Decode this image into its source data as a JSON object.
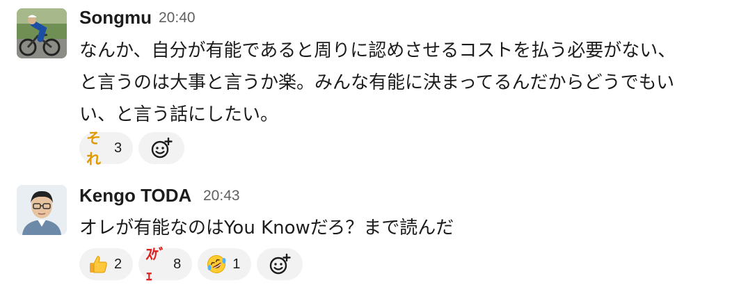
{
  "messages": [
    {
      "author": "Songmu",
      "time": "20:40",
      "lines": [
        "なんか、自分が有能であると周りに認めさせるコストを払う必要がない、",
        "と言うのは大事と言うか楽。みんな有能に決まってるんだからどうでもい",
        "い、と言う話にしたい。"
      ],
      "reactions": [
        {
          "emoji": "それ",
          "emoji_color": "#e09a00",
          "count": "3"
        }
      ]
    },
    {
      "author": "Kengo TODA",
      "time": "20:43",
      "lines": [
        "オレが有能なのはYou Knowだろ？まで読んだ"
      ],
      "reactions": [
        {
          "emoji": "thumbs-up-emoji",
          "count": "2"
        },
        {
          "emoji": "ｽｹﾞｪ",
          "emoji_color": "#e01e1e",
          "count": "8"
        },
        {
          "emoji": "rolling-on-floor-laughing-emoji",
          "count": "1"
        }
      ]
    }
  ],
  "icons": {
    "add_reaction": "add-reaction-icon",
    "avatar_songmu": "cyclist-avatar",
    "avatar_kengo": "person-avatar"
  }
}
